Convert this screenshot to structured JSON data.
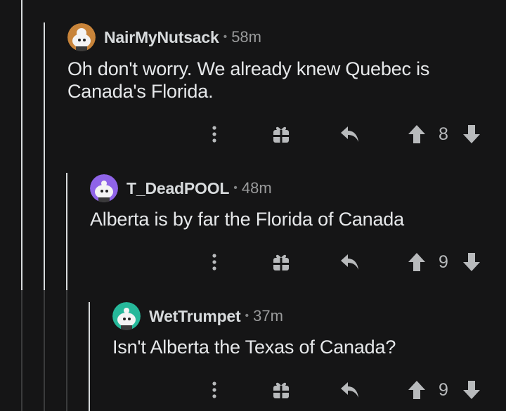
{
  "comments": [
    {
      "username": "NairMyNutsack",
      "separator": "•",
      "time": "58m",
      "body_line1": "Oh don't worry. We already knew Quebec is",
      "body_line2": "Canada's Florida.",
      "score": "8",
      "avatar_color": "#c8843a"
    },
    {
      "username": "T_DeadPOOL",
      "separator": "•",
      "time": "48m",
      "body_line1": "Alberta is by far the Florida of Canada",
      "score": "9",
      "avatar_color": "#8f64e8"
    },
    {
      "username": "WetTrumpet",
      "separator": "•",
      "time": "37m",
      "body_line1": "Isn't Alberta the Texas of Canada?",
      "score": "9",
      "avatar_color": "#26b89a"
    }
  ],
  "icons": [
    "more-options-icon",
    "award-icon",
    "reply-icon",
    "upvote-icon",
    "downvote-icon"
  ],
  "colors": {
    "background": "#151516",
    "thread_line": "#d7dadc",
    "icon": "#b8babc"
  }
}
